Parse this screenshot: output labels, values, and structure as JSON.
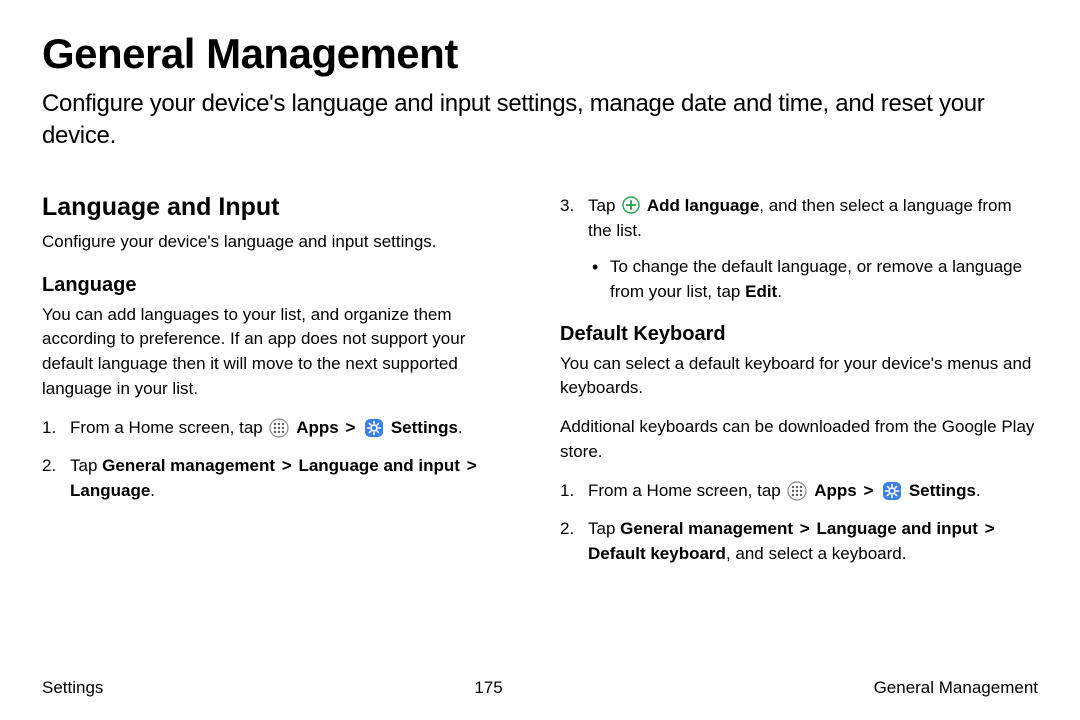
{
  "title": "General Management",
  "intro": "Configure your device's language and input settings, manage date and time, and reset your device.",
  "left": {
    "section_heading": "Language and Input",
    "section_desc": "Configure your device's language and input settings.",
    "sub_heading": "Language",
    "sub_desc": "You can add languages to your list, and organize them according to preference. If an app does not support your default language then it will move to the next supported language in your list.",
    "step1_a": "From a Home screen, tap ",
    "apps_label": "Apps",
    "settings_label": "Settings",
    "step1_period": ".",
    "step2_a": "Tap ",
    "step2_b": "General management",
    "step2_c": "Language and input",
    "step2_d": "Language",
    "step2_period": "."
  },
  "right": {
    "step3_a": "Tap ",
    "add_language_label": "Add language",
    "step3_b": ", and then select a language from the list.",
    "bullet_a": "To change the default language, or remove a language from your list, tap ",
    "bullet_b": "Edit",
    "bullet_c": ".",
    "sub_heading": "Default Keyboard",
    "sub_desc1": "You can select a default keyboard for your device's menus and keyboards.",
    "sub_desc2": "Additional keyboards can be downloaded from the Google Play store.",
    "step1_a": "From a Home screen, tap ",
    "apps_label": "Apps",
    "settings_label": "Settings",
    "step1_period": ".",
    "step2_a": "Tap ",
    "step2_b": "General management",
    "step2_c": "Language and input",
    "step2_d": "Default keyboard",
    "step2_e": ", and select a keyboard."
  },
  "footer": {
    "left": "Settings",
    "center": "175",
    "right": "General Management"
  },
  "chevron": ">"
}
